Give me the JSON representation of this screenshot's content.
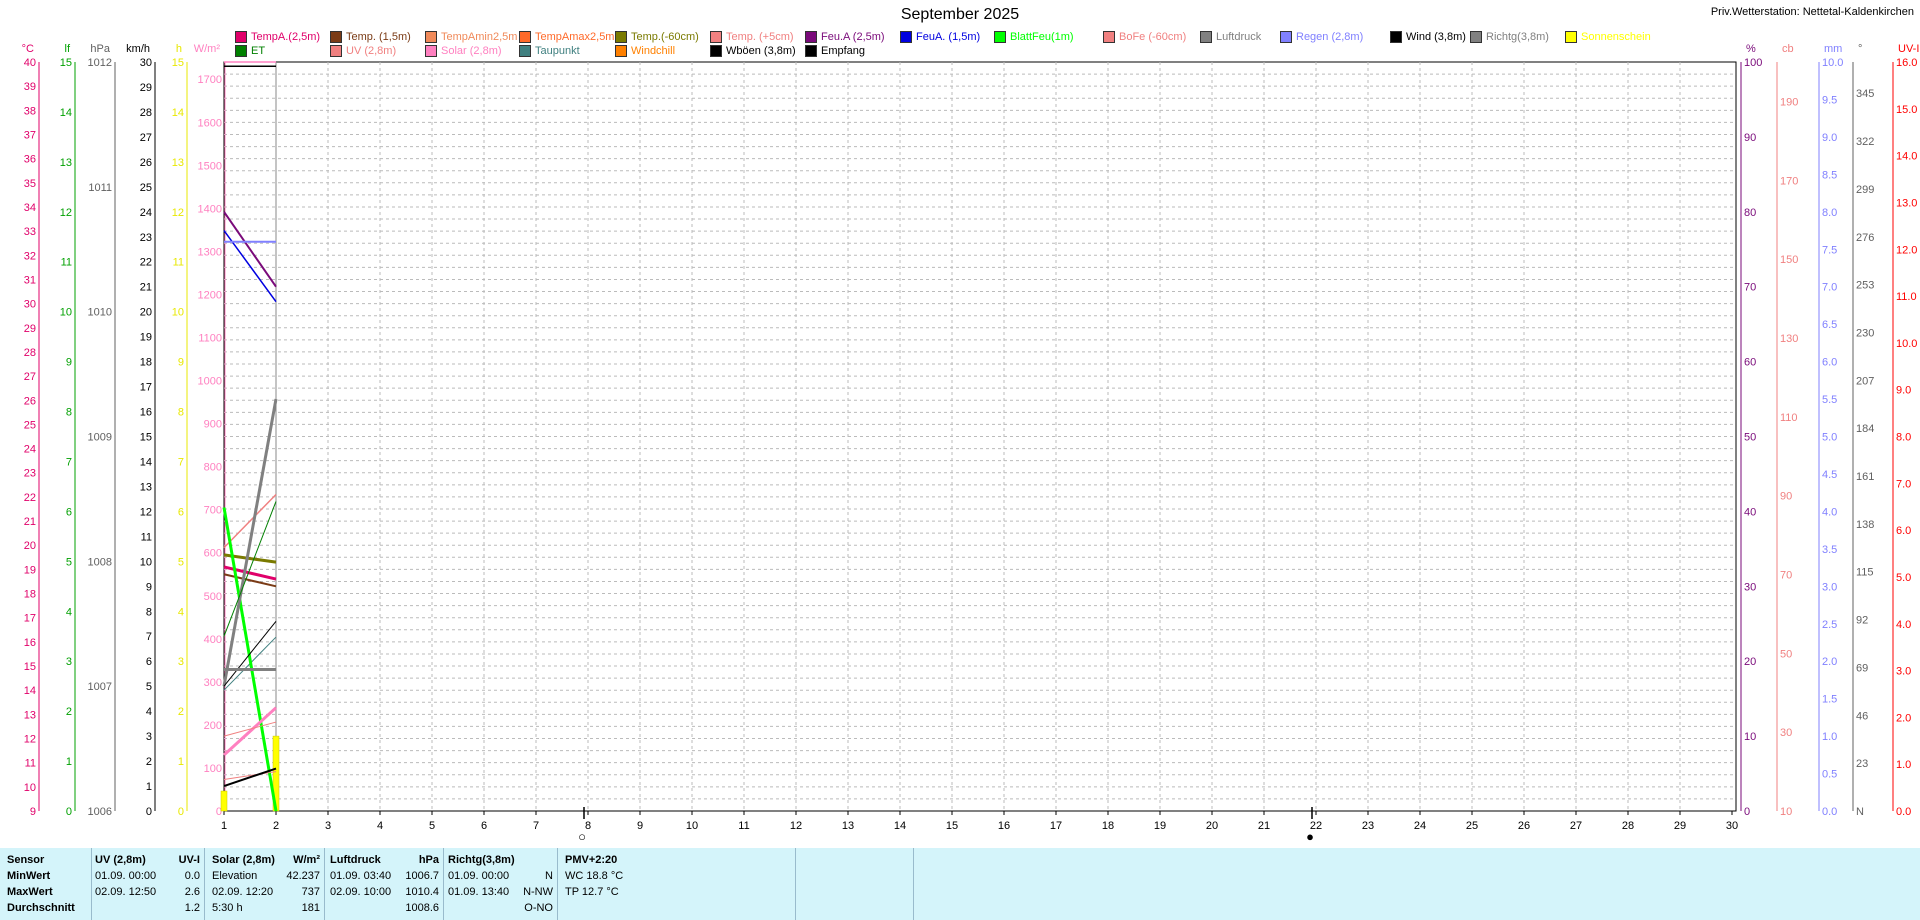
{
  "header": {
    "title": "September 2025",
    "station": "Priv.Wetterstation: Nettetal-Kaldenkirchen"
  },
  "legend": [
    {
      "label": "TempA.(2,5m)",
      "color": "#e0006a"
    },
    {
      "label": "Temp. (1,5m)",
      "color": "#7a3b16"
    },
    {
      "label": "TempAmin2,5m",
      "color": "#f08a5a"
    },
    {
      "label": "TempAmax2,5m",
      "color": "#ff6a2a"
    },
    {
      "label": "Temp.(-60cm)",
      "color": "#7a7a00"
    },
    {
      "label": "Temp. (+5cm)",
      "color": "#f08080"
    },
    {
      "label": "Feu.A (2,5m)",
      "color": "#7a0a7a"
    },
    {
      "label": "FeuA. (1,5m)",
      "color": "#0000e0"
    },
    {
      "label": "BlattFeu(1m)",
      "color": "#00ff00"
    },
    {
      "label": "BoFe (-60cm)",
      "color": "#f08080"
    },
    {
      "label": "Luftdruck",
      "color": "#808080"
    },
    {
      "label": "Regen (2,8m)",
      "color": "#8080ff"
    },
    {
      "label": "Wind (3,8m)",
      "color": "#000000"
    },
    {
      "label": "Richtg(3,8m)",
      "color": "#808080"
    },
    {
      "label": "Sonnenschein",
      "color": "#ffff00"
    },
    {
      "label": "ET",
      "color": "#008000"
    },
    {
      "label": "UV (2,8m)",
      "color": "#f08080"
    },
    {
      "label": "Solar (2,8m)",
      "color": "#ff80c0"
    },
    {
      "label": "Taupunkt",
      "color": "#408080"
    },
    {
      "label": "Windchill",
      "color": "#ff8000"
    },
    {
      "label": "Wböen (3,8m)",
      "color": "#000000"
    },
    {
      "label": "Empfang",
      "color": "#000000"
    }
  ],
  "chart_data": {
    "type": "line",
    "title": "September 2025",
    "x_ticks": [
      "1",
      "2",
      "3",
      "4",
      "5",
      "6",
      "7",
      "8",
      "9",
      "10",
      "11",
      "12",
      "13",
      "14",
      "15",
      "16",
      "17",
      "18",
      "19",
      "20",
      "21",
      "22",
      "23",
      "24",
      "25",
      "26",
      "27",
      "28",
      "29",
      "30"
    ],
    "xlim": [
      1,
      30
    ],
    "markers": [
      {
        "day": 8,
        "symbol": "○"
      },
      {
        "day": 22,
        "symbol": "●"
      }
    ],
    "axes": {
      "temp_c": {
        "unit": "°C",
        "min": 9.0,
        "max": 40.0,
        "step": 0.5,
        "label_step": 1.0,
        "color": "#e0006a"
      },
      "lf": {
        "unit": "lf",
        "min": 0,
        "max": 15,
        "step": 1,
        "color": "#00a000"
      },
      "hpa": {
        "unit": "hPa",
        "min": 1006,
        "max": 1012,
        "step": 1,
        "color": "#606060"
      },
      "kmh": {
        "unit": "km/h",
        "min": 0.0,
        "max": 30.0,
        "step": 1.0,
        "color": "#000000"
      },
      "h": {
        "unit": "h",
        "min": 0,
        "max": 15,
        "step": 1,
        "color": "#ffff00"
      },
      "wm2": {
        "unit": "W/m²",
        "min": 0,
        "max": 1740,
        "label_max": 1700,
        "step": 100,
        "color": "#ff80c0"
      },
      "pct": {
        "unit": "%",
        "min": 0,
        "max": 100,
        "step": 10,
        "color": "#7a0a7a"
      },
      "cb": {
        "unit": "cb",
        "min": 10,
        "max": 200,
        "ticks": [
          10,
          30,
          50,
          70,
          90,
          110,
          130,
          150,
          170,
          190
        ],
        "color": "#f08080"
      },
      "mm": {
        "unit": "mm",
        "min": 0.0,
        "max": 10.0,
        "step": 0.5,
        "color": "#8080ff"
      },
      "deg": {
        "unit": "°",
        "min": 0,
        "max": 360,
        "ticks": [
          0,
          23,
          46,
          69,
          92,
          115,
          138,
          161,
          184,
          207,
          230,
          253,
          276,
          299,
          322,
          345
        ],
        "first_label": "N",
        "color": "#606060"
      },
      "uvi": {
        "unit": "UV-I",
        "min": 0.0,
        "max": 16.0,
        "step": 0.5,
        "color": "#ff0000"
      }
    },
    "series": [
      {
        "name": "TempA.(2,5m)",
        "axis": "temp_c",
        "color": "#e0006a",
        "width": 3,
        "points": [
          [
            1,
            19.1
          ],
          [
            2,
            18.6
          ]
        ]
      },
      {
        "name": "Temp. (1,5m)",
        "axis": "temp_c",
        "color": "#7a3b16",
        "width": 2,
        "points": [
          [
            1,
            18.8
          ],
          [
            2,
            18.3
          ]
        ]
      },
      {
        "name": "Temp.(-60cm)",
        "axis": "temp_c",
        "color": "#7a7a00",
        "width": 3,
        "points": [
          [
            1,
            19.6
          ],
          [
            2,
            19.3
          ]
        ]
      },
      {
        "name": "Temp. (+5cm)",
        "axis": "temp_c",
        "color": "#f08080",
        "width": 1.5,
        "points": [
          [
            1,
            19.9
          ],
          [
            2,
            22.1
          ]
        ]
      },
      {
        "name": "Taupunkt",
        "axis": "temp_c",
        "color": "#408080",
        "width": 1,
        "points": [
          [
            1,
            14.0
          ],
          [
            2,
            16.2
          ]
        ]
      },
      {
        "name": "Feu.A (2,5m)",
        "axis": "pct",
        "color": "#7a0a7a",
        "width": 2,
        "points": [
          [
            1,
            80.0
          ],
          [
            2,
            70.0
          ]
        ]
      },
      {
        "name": "FeuA. (1,5m)",
        "axis": "pct",
        "color": "#0000e0",
        "width": 1.5,
        "points": [
          [
            1,
            77.5
          ],
          [
            2,
            68.0
          ]
        ]
      },
      {
        "name": "BlattFeu(1m)",
        "axis": "cb",
        "color": "#00ff00",
        "width": 3,
        "points": [
          [
            1,
            87
          ],
          [
            2,
            10
          ]
        ]
      },
      {
        "name": "BoFe (-60cm)",
        "axis": "cb",
        "color": "#f08080",
        "width": 1,
        "points": [
          [
            1,
            18
          ],
          [
            2,
            20
          ]
        ]
      },
      {
        "name": "Luftdruck",
        "axis": "hpa",
        "color": "#808080",
        "width": 3,
        "points": [
          [
            1,
            1007.0
          ],
          [
            2,
            1009.3
          ]
        ]
      },
      {
        "name": "Regen (2,8m)",
        "axis": "mm",
        "color": "#8080ff",
        "width": 2,
        "points": [
          [
            1,
            7.6
          ],
          [
            2,
            7.6
          ]
        ]
      },
      {
        "name": "Wind (3,8m)",
        "axis": "kmh",
        "color": "#000000",
        "width": 2,
        "points": [
          [
            1,
            1.0
          ],
          [
            2,
            1.7
          ]
        ]
      },
      {
        "name": "Wböen (3,8m)",
        "axis": "kmh",
        "color": "#000000",
        "width": 1,
        "points": [
          [
            1,
            5.0
          ],
          [
            2,
            7.6
          ]
        ]
      },
      {
        "name": "Richtg(3,8m)",
        "axis": "deg",
        "color": "#808080",
        "width": 3,
        "points": [
          [
            1,
            68
          ],
          [
            2,
            68
          ]
        ]
      },
      {
        "name": "Solar (2,8m)",
        "axis": "wm2",
        "color": "#ff80c0",
        "width": 3,
        "points": [
          [
            1,
            130
          ],
          [
            2,
            240
          ]
        ]
      },
      {
        "name": "UV (2,8m)",
        "axis": "uvi",
        "color": "#f08080",
        "width": 1,
        "points": [
          [
            1,
            1.6
          ],
          [
            2,
            1.9
          ]
        ]
      },
      {
        "name": "ET",
        "axis": "lf",
        "color": "#008000",
        "width": 1,
        "points": [
          [
            1,
            3.5
          ],
          [
            2,
            6.2
          ]
        ]
      },
      {
        "name": "Empfang",
        "axis": "wm2",
        "color": "#000000",
        "width": 1.5,
        "points": [
          [
            1,
            1730
          ],
          [
            2,
            1730
          ]
        ]
      },
      {
        "name": "Empfang",
        "axis": "wm2",
        "color": "#ff80c0",
        "width": 1.5,
        "points": [
          [
            1,
            1740
          ],
          [
            2,
            1740
          ]
        ]
      }
    ],
    "bars": [
      {
        "name": "Sonnenschein",
        "axis": "h",
        "color": "#ffff00",
        "points": [
          [
            1,
            0.4
          ],
          [
            2,
            1.5
          ]
        ]
      }
    ]
  },
  "stats": {
    "row_labels": [
      "Sensor",
      "MinWert",
      "MaxWert",
      "Durchschnitt"
    ],
    "uv": {
      "header": "UV (2,8m)",
      "unit": "UV-I",
      "min_time": "01.09.  00:00",
      "min_val": "0.0",
      "max_time": "02.09.  12:50",
      "max_val": "2.6",
      "avg_val": "1.2"
    },
    "solar": {
      "header": "Solar (2,8m)",
      "unit": "W/m²",
      "elev_label": "Elevation",
      "elev_val": "42.237",
      "max_time": "02.09.  12:20",
      "max_val": "737",
      "dur_label": "5:30 h",
      "avg_val": "181"
    },
    "pressure": {
      "header": "Luftdruck",
      "unit": "hPa",
      "min_time": "01.09.  03:40",
      "min_val": "1006.7",
      "max_time": "02.09.  10:00",
      "max_val": "1010.4",
      "avg_val": "1008.6"
    },
    "direction": {
      "header": "Richtg(3,8m)",
      "min_time": "01.09.  00:00",
      "min_val": "N",
      "max_time": "01.09.  13:40",
      "max_val": "N-NW",
      "avg_val": "O-NO"
    },
    "pmv": {
      "header": "PMV+2:20",
      "wc": "WC 18.8 °C",
      "tp": "TP 12.7 °C"
    }
  }
}
